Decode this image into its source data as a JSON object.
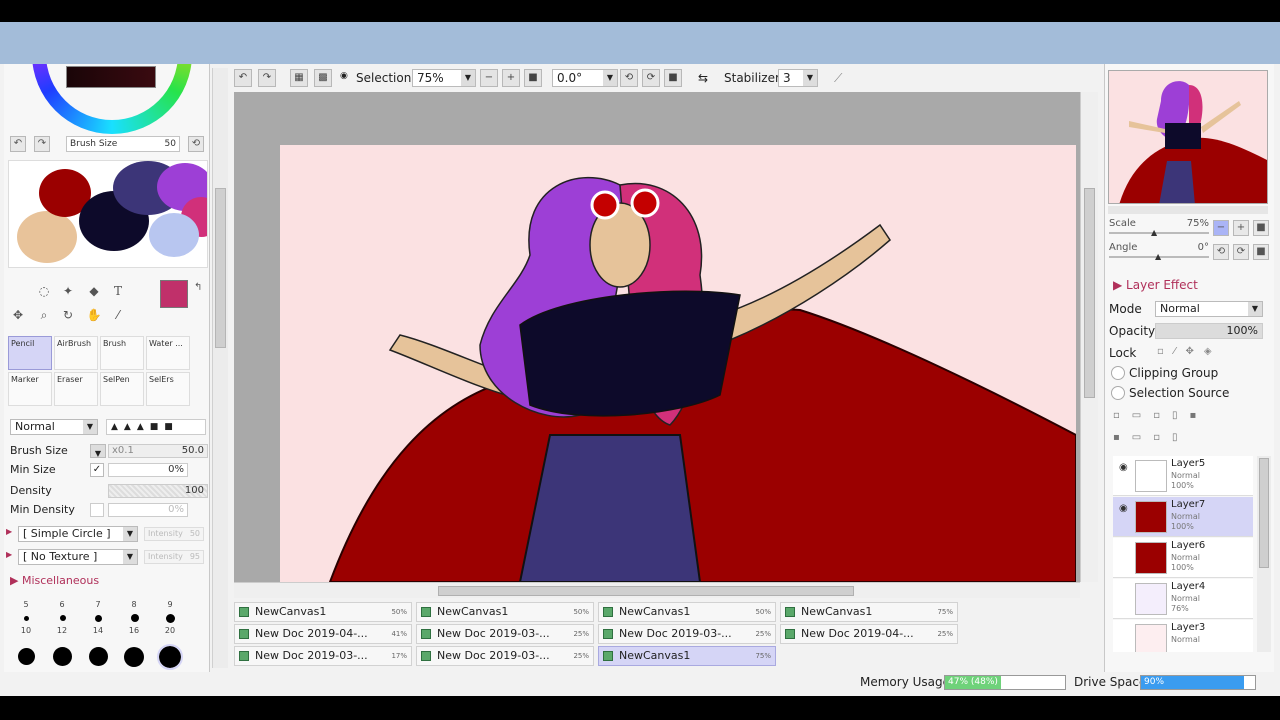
{
  "toolbar": {
    "selection_label": "Selection",
    "zoom_value": "75%",
    "rotation_value": "0.0°",
    "stabilizer_label": "Stabilizer",
    "stabilizer_value": "3"
  },
  "left_panel": {
    "brush_size_mini_label": "Brush Size",
    "brush_size_mini_value": "50",
    "text_tool_glyph": "T",
    "brushes": [
      {
        "label": "Pencil"
      },
      {
        "label": "AirBrush"
      },
      {
        "label": "Brush"
      },
      {
        "label": "Water ..."
      },
      {
        "label": "Marker"
      },
      {
        "label": "Eraser"
      },
      {
        "label": "SelPen"
      },
      {
        "label": "SelErs"
      }
    ],
    "blend_mode": "Normal",
    "brush_size_label": "Brush Size",
    "brush_size_multiplier": "x0.1",
    "brush_size_value": "50.0",
    "min_size_label": "Min Size",
    "min_size_value": "0%",
    "density_label": "Density",
    "density_value": "100",
    "min_density_label": "Min Density",
    "min_density_value": "0%",
    "shape_dropdown": "[ Simple Circle ]",
    "texture_dropdown": "[ No Texture ]",
    "intensity_label": "Intensity",
    "intensity_value_1": "50",
    "intensity_value_2": "95",
    "misc_label": "Miscellaneous",
    "dot_sizes_row1": [
      "5",
      "6",
      "7",
      "8",
      "9"
    ],
    "dot_sizes_row2": [
      "10",
      "12",
      "14",
      "16",
      "20"
    ]
  },
  "doc_tabs": [
    {
      "name": "NewCanvas1",
      "pct": "50%"
    },
    {
      "name": "NewCanvas1",
      "pct": "50%"
    },
    {
      "name": "NewCanvas1",
      "pct": "50%"
    },
    {
      "name": "NewCanvas1",
      "pct": "75%"
    },
    {
      "name": "New Doc 2019-04-...",
      "pct": "41%"
    },
    {
      "name": "New Doc 2019-03-...",
      "pct": "25%"
    },
    {
      "name": "New Doc 2019-03-...",
      "pct": "25%"
    },
    {
      "name": "New Doc 2019-04-...",
      "pct": "25%"
    },
    {
      "name": "New Doc 2019-03-...",
      "pct": "17%"
    },
    {
      "name": "New Doc 2019-03-...",
      "pct": "25%"
    },
    {
      "name": "NewCanvas1",
      "pct": "75%"
    }
  ],
  "status": {
    "memory_label": "Memory Usage",
    "memory_value": "47% (48%)",
    "memory_fraction": 0.47,
    "drive_label": "Drive Space",
    "drive_value": "90%",
    "drive_fraction": 0.9
  },
  "right_panel": {
    "scale_label": "Scale",
    "scale_value": "75%",
    "angle_label": "Angle",
    "angle_value": "0°",
    "layer_effect_label": "Layer Effect",
    "mode_label": "Mode",
    "mode_value": "Normal",
    "opacity_label": "Opacity",
    "opacity_value": "100%",
    "lock_label": "Lock",
    "clipping_group_label": "Clipping Group",
    "selection_source_label": "Selection Source",
    "layers": [
      {
        "name": "Layer5",
        "mode": "Normal",
        "opacity": "100%"
      },
      {
        "name": "Layer7",
        "mode": "Normal",
        "opacity": "100%"
      },
      {
        "name": "Layer6",
        "mode": "Normal",
        "opacity": "100%"
      },
      {
        "name": "Layer4",
        "mode": "Normal",
        "opacity": "76%"
      },
      {
        "name": "Layer3",
        "mode": "Normal",
        "opacity": ""
      }
    ]
  },
  "colors": {
    "foreground": "#c0306a",
    "canvas_bg": "#fbe1e2",
    "cape": "#9b0000",
    "hair_purple": "#9d3fd6",
    "hair_pink": "#d1307a",
    "shirt": "#0d0a2a",
    "pants": "#3c3578",
    "skin": "#e6c39a",
    "selection_highlight": "#d5d5f6"
  }
}
